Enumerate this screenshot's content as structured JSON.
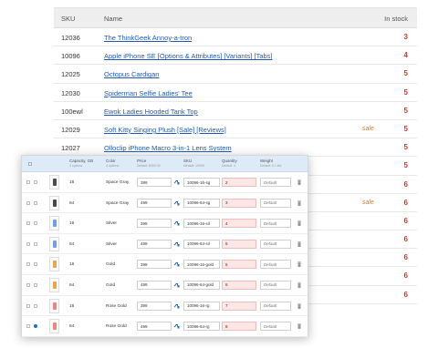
{
  "products": {
    "headers": {
      "sku": "SKU",
      "name": "Name",
      "stock": "In stock"
    },
    "rows": [
      {
        "sku": "12036",
        "name": "The ThinkGeek Annoy-a-tron",
        "sale": "",
        "stock": "3"
      },
      {
        "sku": "10096",
        "name": "Apple iPhone SE [Options & Attributes] [Variants] [Tabs]",
        "sale": "",
        "stock": "4"
      },
      {
        "sku": "12025",
        "name": "Octopus Cardigan",
        "sale": "",
        "stock": "5"
      },
      {
        "sku": "12030",
        "name": "Spiderman Selfie Ladies' Tee",
        "sale": "",
        "stock": "5"
      },
      {
        "sku": "100ewl",
        "name": "Ewok Ladies Hooded Tank Top",
        "sale": "",
        "stock": "5"
      },
      {
        "sku": "12029",
        "name": "Soft Kitty Singing Plush [Sale] [Reviews]",
        "sale": "sale",
        "stock": "5"
      },
      {
        "sku": "12027",
        "name": "Olloclip iPhone Macro 3-in-1 Lens System",
        "sale": "",
        "stock": "5"
      },
      {
        "sku": "",
        "name": "",
        "sale": "",
        "stock": "5"
      },
      {
        "sku": "",
        "name": "",
        "sale": "",
        "stock": "6"
      },
      {
        "sku": "",
        "name": "",
        "sale": "sale",
        "stock": "6"
      },
      {
        "sku": "",
        "name": "",
        "sale": "",
        "stock": "6"
      },
      {
        "sku": "",
        "name": "",
        "sale": "",
        "stock": "6"
      },
      {
        "sku": "",
        "name": "",
        "sale": "",
        "stock": "6"
      },
      {
        "sku": "",
        "name": "",
        "sale": "",
        "stock": "6"
      },
      {
        "sku": "",
        "name": "",
        "sale": "",
        "stock": "6"
      }
    ]
  },
  "variants": {
    "headers": {
      "capacity": "Capacity, GB",
      "capacity_sub": "4 options",
      "color": "Color",
      "color_sub": "4 options",
      "price": "Price",
      "price_sub": "Default: $499.00",
      "sku": "SKU",
      "sku_sub": "Default: 10096",
      "quantity": "Quantity",
      "quantity_sub": "Default: 4",
      "weight": "Weight",
      "weight_sub": "Default: 0.1 lbs"
    },
    "weight_placeholder": "Default",
    "rows": [
      {
        "capacity": "16",
        "color": "Space Gray",
        "price": "399",
        "sku": "10096-16-sg",
        "qty": "2",
        "thumb_color": "#4a4a4a"
      },
      {
        "capacity": "64",
        "color": "Space Gray",
        "price": "499",
        "sku": "10096-64-sg",
        "qty": "3",
        "thumb_color": "#4a4a4a"
      },
      {
        "capacity": "16",
        "color": "Silver",
        "price": "399",
        "sku": "10096-16-sil",
        "qty": "4",
        "thumb_color": "#6fa0e0"
      },
      {
        "capacity": "64",
        "color": "Silver",
        "price": "499",
        "sku": "10096-64-sil",
        "qty": "5",
        "thumb_color": "#6fa0e0"
      },
      {
        "capacity": "16",
        "color": "Gold",
        "price": "399",
        "sku": "10096-16-gold",
        "qty": "6",
        "thumb_color": "#e8a64a"
      },
      {
        "capacity": "64",
        "color": "Gold",
        "price": "499",
        "sku": "10096-64-gold",
        "qty": "6",
        "thumb_color": "#e8a64a"
      },
      {
        "capacity": "16",
        "color": "Rose Gold",
        "price": "399",
        "sku": "10096-16-rg",
        "qty": "7",
        "thumb_color": "#e88a7a"
      },
      {
        "capacity": "64",
        "color": "Rose Gold",
        "price": "499",
        "sku": "10096-64-rg",
        "qty": "8",
        "thumb_color": "#e88a7a"
      }
    ]
  }
}
